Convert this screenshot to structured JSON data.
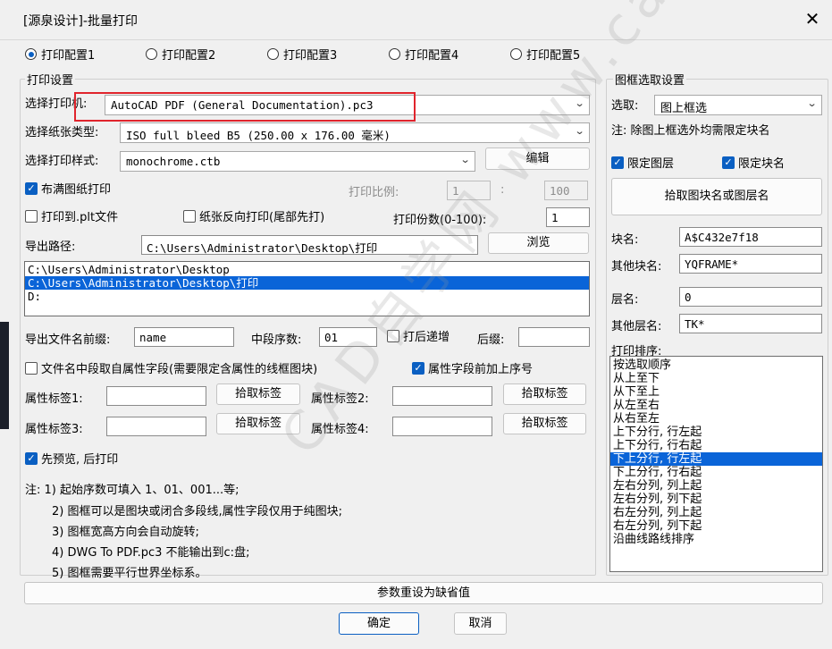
{
  "window": {
    "title": "[源泉设计]-批量打印",
    "close": "✕"
  },
  "configs": [
    {
      "label": "打印配置1",
      "selected": true
    },
    {
      "label": "打印配置2",
      "selected": false
    },
    {
      "label": "打印配置3",
      "selected": false
    },
    {
      "label": "打印配置4",
      "selected": false
    },
    {
      "label": "打印配置5",
      "selected": false
    }
  ],
  "print_settings": {
    "group_label": "打印设置",
    "printer_label": "选择打印机:",
    "printer_value": "AutoCAD PDF (General Documentation).pc3",
    "paper_label": "选择纸张类型:",
    "paper_value": "ISO full bleed B5 (250.00 x 176.00 毫米)",
    "style_label": "选择打印样式:",
    "style_value": "monochrome.ctb",
    "edit_button": "编辑",
    "fill_paper_label": "布满图纸打印",
    "fill_paper_checked": true,
    "scale_label": "打印比例:",
    "scale_a": "1",
    "scale_sep": ":",
    "scale_b": "100",
    "plt_label": "打印到.plt文件",
    "plt_checked": false,
    "reverse_label": "纸张反向打印(尾部先打)",
    "reverse_checked": false,
    "copies_label": "打印份数(0-100):",
    "copies_value": "1",
    "export_path_label": "导出路径:",
    "export_path_value": "C:\\Users\\Administrator\\Desktop\\打印",
    "browse_button": "浏览",
    "path_list": [
      {
        "text": "C:\\Users\\Administrator\\Desktop",
        "selected": false
      },
      {
        "text": "C:\\Users\\Administrator\\Desktop\\打印",
        "selected": true
      },
      {
        "text": "D:",
        "selected": false
      }
    ],
    "prefix_label": "导出文件名前缀:",
    "prefix_value": "name",
    "mid_seq_label": "中段序数:",
    "mid_seq_value": "01",
    "increment_label": "打后递增",
    "increment_checked": false,
    "suffix_label": "后缀:",
    "suffix_value": "",
    "attr_mid_label": "文件名中段取自属性字段(需要限定含属性的线框图块)",
    "attr_mid_checked": false,
    "attr_seq_label": "属性字段前加上序号",
    "attr_seq_checked": true,
    "attr1_label": "属性标签1:",
    "attr2_label": "属性标签2:",
    "attr3_label": "属性标签3:",
    "attr4_label": "属性标签4:",
    "pick_tag_button": "拾取标签",
    "preview_label": "先预览, 后打印",
    "preview_checked": true,
    "notes": [
      "注: 1) 起始序数可填入 1、01、001...等;",
      "2) 图框可以是图块或闭合多段线,属性字段仅用于纯图块;",
      "3) 图框宽高方向会自动旋转;",
      "4) DWG To PDF.pc3 不能输出到c:盘;",
      "5) 图框需要平行世界坐标系。"
    ]
  },
  "frame_settings": {
    "group_label": "图框选取设置",
    "pick_label": "选取:",
    "pick_value": "图上框选",
    "note": "注: 除图上框选外均需限定块名",
    "limit_layer_label": "限定图层",
    "limit_layer_checked": true,
    "limit_block_label": "限定块名",
    "limit_block_checked": true,
    "pick_block_button": "拾取图块名或图层名",
    "block_name_label": "块名:",
    "block_name_value": "A$C432e7f18",
    "other_block_label": "其他块名:",
    "other_block_value": "YQFRAME*",
    "layer_label": "层名:",
    "layer_value": "0",
    "other_layer_label": "其他层名:",
    "other_layer_value": "TK*",
    "sort_label": "打印排序:",
    "sort_items": [
      {
        "text": "按选取顺序",
        "selected": false
      },
      {
        "text": "从上至下",
        "selected": false
      },
      {
        "text": "从下至上",
        "selected": false
      },
      {
        "text": "从左至右",
        "selected": false
      },
      {
        "text": "从右至左",
        "selected": false
      },
      {
        "text": "上下分行, 行左起",
        "selected": false
      },
      {
        "text": "上下分行, 行右起",
        "selected": false
      },
      {
        "text": "下上分行, 行左起",
        "selected": true
      },
      {
        "text": "下上分行, 行右起",
        "selected": false
      },
      {
        "text": "左右分列, 列上起",
        "selected": false
      },
      {
        "text": "左右分列, 列下起",
        "selected": false
      },
      {
        "text": "右左分列, 列上起",
        "selected": false
      },
      {
        "text": "右左分列, 列下起",
        "selected": false
      },
      {
        "text": "沿曲线路线排序",
        "selected": false
      }
    ]
  },
  "footer": {
    "reset_button": "参数重设为缺省值",
    "ok_button": "确定",
    "cancel_button": "取消"
  },
  "watermark": "CAD自学网 www.cadzxw.com",
  "colors": {
    "accent": "#0a5fc2",
    "selection": "#0a64d8",
    "highlight_box": "#e0242c"
  }
}
